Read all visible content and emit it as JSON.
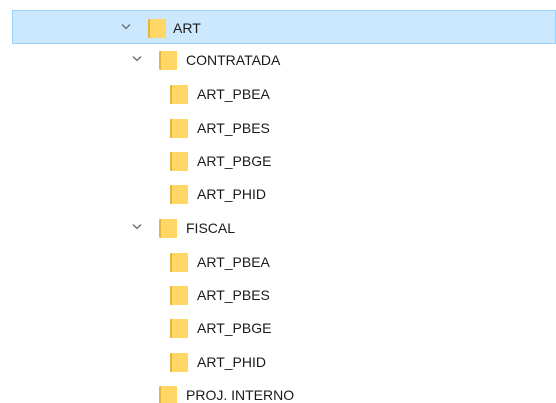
{
  "tree": {
    "root": {
      "label": "ART",
      "expanded": true,
      "selected": true,
      "icon": "folder-icon",
      "chevron": "chevron-down-icon"
    },
    "contratada": {
      "label": "CONTRATADA",
      "expanded": true,
      "icon": "folder-icon",
      "chevron": "chevron-down-icon",
      "children": [
        "ART_PBEA",
        "ART_PBES",
        "ART_PBGE",
        "ART_PHID"
      ]
    },
    "fiscal": {
      "label": "FISCAL",
      "expanded": true,
      "icon": "folder-icon",
      "chevron": "chevron-down-icon",
      "children": [
        "ART_PBEA",
        "ART_PBES",
        "ART_PBGE",
        "ART_PHID"
      ]
    },
    "proj_interno": {
      "label": "PROJ. INTERNO",
      "expanded": false,
      "icon": "folder-icon"
    }
  },
  "colors": {
    "selection_background": "#cce8ff",
    "selection_border": "#99d1ff",
    "folder_fill": "#ffd767",
    "folder_dark": "#e8b43a",
    "chevron": "#6b6b6b",
    "text": "#1a1a1a"
  }
}
